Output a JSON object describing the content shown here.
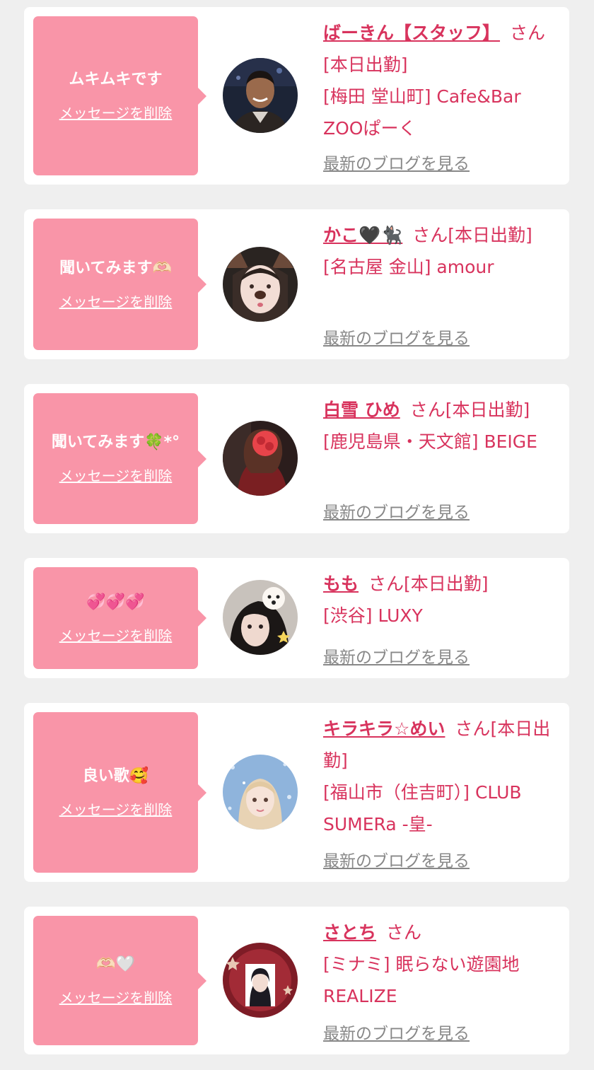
{
  "colors": {
    "background": "#efefef",
    "card": "#ffffff",
    "bubble": "#f995a8",
    "accent": "#d8335d",
    "link_gray": "#888888"
  },
  "items": [
    {
      "message": "ムキムキです",
      "delete_label": "メッセージを削除",
      "name": "ばーきん【スタッフ】",
      "honorific": "さん",
      "status": "[本日出勤]",
      "shop": "[梅田 堂山町] Cafe&Bar ZOOぱーく",
      "blog_label": "最新のブログを見る"
    },
    {
      "message": "聞いてみます🫶🏻",
      "delete_label": "メッセージを削除",
      "name": "かこ🖤🐈‍⬛",
      "honorific": "さん",
      "status": "[本日出勤]",
      "shop": "[名古屋 金山] amour",
      "blog_label": "最新のブログを見る"
    },
    {
      "message": "聞いてみます🍀*°",
      "delete_label": "メッセージを削除",
      "name": "白雪 ひめ",
      "honorific": "さん",
      "status": "[本日出勤]",
      "shop": "[鹿児島県・天文館] BEIGE",
      "blog_label": "最新のブログを見る"
    },
    {
      "message": "💞💞💞",
      "delete_label": "メッセージを削除",
      "name": "もも",
      "honorific": "さん",
      "status": "[本日出勤]",
      "shop": "[渋谷] LUXY",
      "blog_label": "最新のブログを見る"
    },
    {
      "message": "良い歌🥰",
      "delete_label": "メッセージを削除",
      "name": "キラキラ☆めい",
      "honorific": "さん",
      "status": "[本日出勤]",
      "shop": "[福山市（住吉町）] CLUB SUMERa -皇-",
      "blog_label": "最新のブログを見る"
    },
    {
      "message": "🫶🏻🤍",
      "delete_label": "メッセージを削除",
      "name": "さとち",
      "honorific": "さん",
      "status": "",
      "shop": "[ミナミ] 眠らない遊園地REALIZE",
      "blog_label": "最新のブログを見る"
    }
  ]
}
